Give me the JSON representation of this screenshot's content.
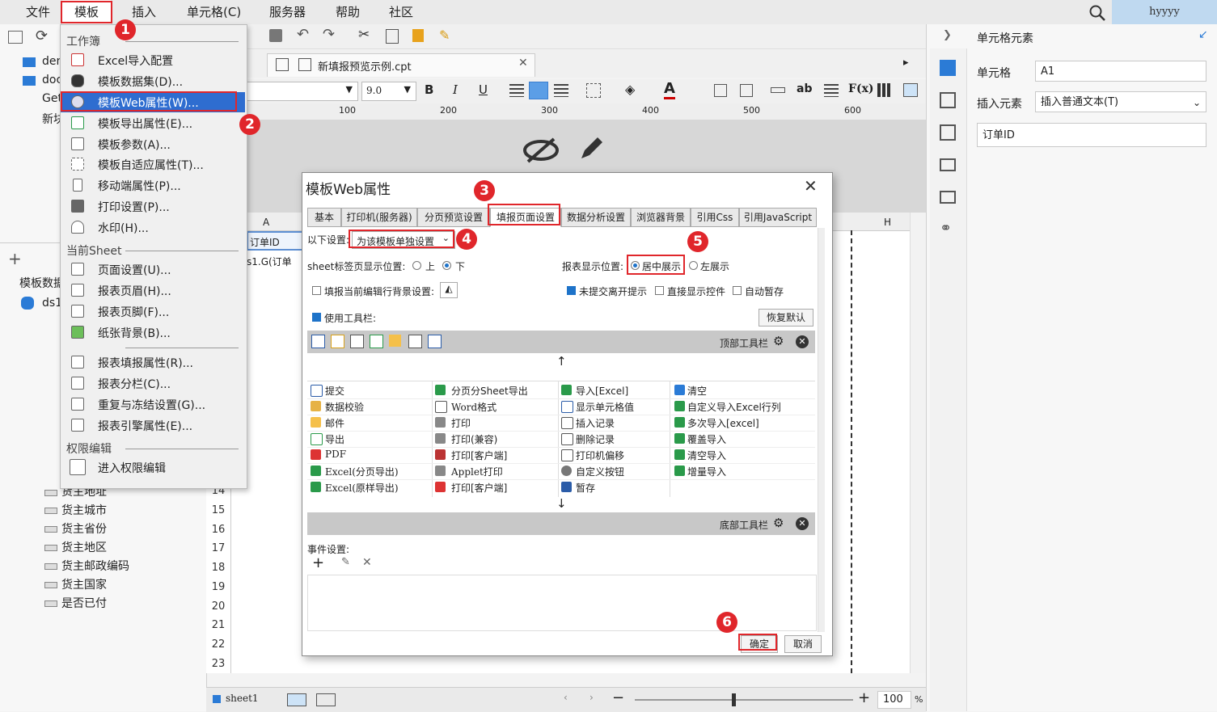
{
  "menubar": {
    "items": [
      "文件",
      "模板",
      "插入",
      "单元格(C)",
      "服务器",
      "帮助",
      "社区"
    ],
    "user": "hyyyy"
  },
  "left_panel": {
    "tree_files": [
      "dem",
      "doc",
      "Get",
      "新块"
    ],
    "dataset_header": "模板数据",
    "dataset_name": "ds1",
    "fields": [
      "货主地址",
      "货主城市",
      "货主省份",
      "货主地区",
      "货主邮政编码",
      "货主国家",
      "是否已付"
    ]
  },
  "dropdown": {
    "section_workbook": "工作簿",
    "workbook_items": [
      "Excel导入配置",
      "模板数据集(D)...",
      "模板Web属性(W)...",
      "模板导出属性(E)...",
      "模板参数(A)...",
      "模板自适应属性(T)...",
      "移动端属性(P)...",
      "打印设置(P)...",
      "水印(H)..."
    ],
    "section_sheet": "当前Sheet",
    "sheet_items": [
      "页面设置(U)...",
      "报表页眉(H)...",
      "报表页脚(F)...",
      "纸张背景(B)...",
      "报表填报属性(R)...",
      "报表分栏(C)...",
      "重复与冻结设置(G)...",
      "报表引擎属性(E)..."
    ],
    "section_permission": "权限编辑",
    "permission_items": [
      "进入权限编辑"
    ]
  },
  "editor": {
    "doc_tab": "新填报预览示例.cpt",
    "font_size": "9.0",
    "ruler_marks": [
      "100",
      "200",
      "300",
      "400",
      "500",
      "600"
    ],
    "column_a": "A",
    "column_h": "H",
    "cell_a1": "订单ID",
    "cell_a2": "s1.G(订单",
    "row_numbers": [
      "14",
      "15",
      "16",
      "17",
      "18",
      "19",
      "20",
      "21",
      "22",
      "23"
    ],
    "sheet_tab": "sheet1",
    "zoom": "100",
    "zoom_unit": "%"
  },
  "right_panel": {
    "title": "单元格元素",
    "cell_label": "单元格",
    "cell_value": "A1",
    "insert_label": "插入元素",
    "insert_value": "插入普通文本(T)",
    "content": "订单ID"
  },
  "dialog": {
    "title": "模板Web属性",
    "tabs": [
      "基本",
      "打印机(服务器)",
      "分页预览设置",
      "填报页面设置",
      "数据分析设置",
      "浏览器背景",
      "引用Css",
      "引用JavaScript"
    ],
    "setting_label": "以下设置:",
    "setting_value": "为该模板单独设置",
    "sheet_tab_pos_label": "sheet标签页显示位置:",
    "opt_top": "上",
    "opt_bottom": "下",
    "report_pos_label": "报表显示位置:",
    "opt_center": "居中展示",
    "opt_left": "左展示",
    "fill_bg_label": "填报当前编辑行背景设置:",
    "unsubmitted_label": "未提交离开提示",
    "direct_show_label": "直接显示控件",
    "auto_save_label": "自动暂存",
    "use_toolbar_label": "使用工具栏:",
    "restore_default": "恢复默认",
    "top_toolbar": "顶部工具栏",
    "bottom_toolbar": "底部工具栏",
    "toolbar_buttons": [
      [
        "提交",
        "分页分Sheet导出",
        "导入[Excel]",
        "清空"
      ],
      [
        "数据校验",
        "Word格式",
        "显示单元格值",
        "自定义导入Excel行列"
      ],
      [
        "邮件",
        "打印",
        "插入记录",
        "多次导入[excel]"
      ],
      [
        "导出",
        "打印(兼容)",
        "删除记录",
        "覆盖导入"
      ],
      [
        "PDF",
        "打印[客户端]",
        "打印机偏移",
        "清空导入"
      ],
      [
        "Excel(分页导出)",
        "Applet打印",
        "自定义按钮",
        "增量导入"
      ],
      [
        "Excel(原样导出)",
        "打印[客户端]",
        "暂存",
        ""
      ]
    ],
    "event_label": "事件设置:",
    "ok": "确定",
    "cancel": "取消"
  },
  "badges": [
    "1",
    "2",
    "3",
    "4",
    "5",
    "6"
  ],
  "colors": {
    "accent": "#1e73c9",
    "highlight": "#e0262b",
    "selected_menu": "#2e6dd0"
  }
}
